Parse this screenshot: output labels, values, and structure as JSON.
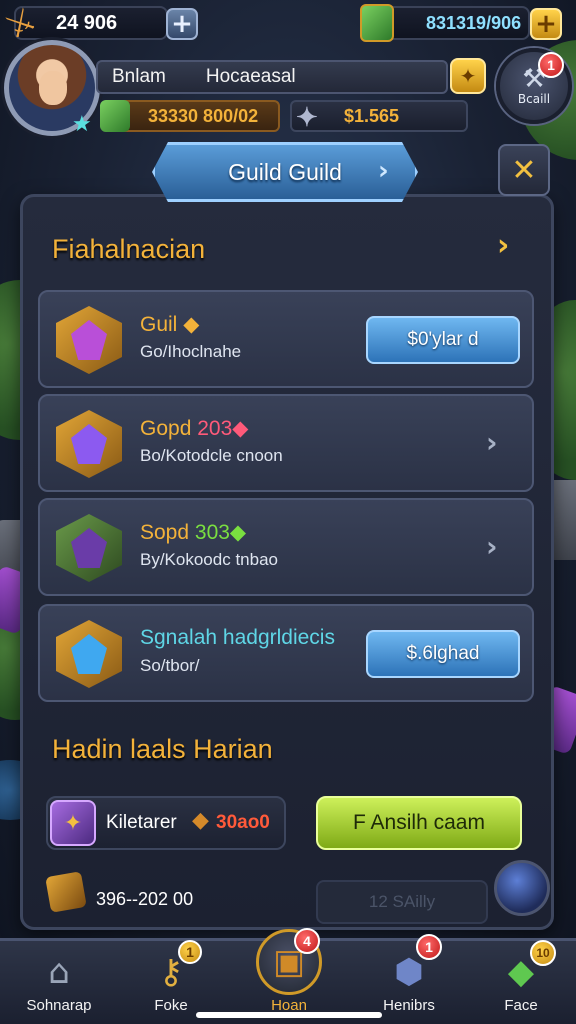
{
  "top_bar": {
    "energy": {
      "icon": "sword-icon",
      "value": "24 906",
      "plus": "+"
    },
    "gems": {
      "icon": "gem-icon",
      "value": "831319/906",
      "plus": "+"
    }
  },
  "player": {
    "name_left": "Bnlam",
    "name_right": "Hocaeasal",
    "gold_value": "33330 800/02",
    "ore_value": "$1.565"
  },
  "settings": {
    "label": "Bcaill",
    "badge": "1"
  },
  "panel": {
    "tab_label": "Guild Guild",
    "tab_arrow": "›",
    "close": "✕",
    "section1_title": "Fiahalnacian",
    "section1_arrow": "›",
    "cards": [
      {
        "title": "Guil",
        "title_suffix": "◆",
        "subtitle": "Go/Ihoclnahe",
        "button": "$0'ylar d",
        "has_button": true,
        "colors": {
          "gem": "#b94fd8",
          "frame": "#d9a237"
        }
      },
      {
        "title": "Gopd",
        "title_suffix": "203◆",
        "subtitle": "Bo/Kotodcle cnoon",
        "button": "",
        "has_button": false,
        "colors": {
          "gem": "#8c5af0",
          "frame": "#d9a237"
        }
      },
      {
        "title": "Sopd",
        "title_suffix": "303◆",
        "subtitle": "By/Kokoodc tnbao",
        "button": "",
        "has_button": false,
        "colors": {
          "gem": "#6a3ca8",
          "frame": "#4f7a36"
        }
      },
      {
        "title": "Sgnalah hadgrldiecis",
        "title_suffix": "",
        "subtitle": "So/tbor/",
        "button": "$.6lghad",
        "has_button": true,
        "colors": {
          "gem": "#3fa8f0",
          "frame": "#d9a237"
        }
      }
    ],
    "section2_title": "Hadin laals Harian",
    "promo": {
      "label": "Kiletarer",
      "value": "30ao0",
      "button": "F Ansilh caam"
    },
    "footer": {
      "text": "396--202 00",
      "dim_button": "12 SAilly"
    }
  },
  "nav": {
    "items": [
      {
        "label": "Sohnarap",
        "icon": "castle-icon",
        "glyph": "⌂",
        "badge": ""
      },
      {
        "label": "Foke",
        "icon": "key-icon",
        "glyph": "⚷",
        "badge": "1"
      },
      {
        "label": "Hoan",
        "icon": "chest-icon",
        "glyph": "▣",
        "badge": "4"
      },
      {
        "label": "Henibrs",
        "icon": "shield-icon",
        "glyph": "⬢",
        "badge": "1"
      },
      {
        "label": "Face",
        "icon": "crystal-icon",
        "glyph": "◆",
        "badge": "10"
      }
    ],
    "active_index": 2
  },
  "colors": {
    "accent_gold": "#f3b23a",
    "button_blue": "#2d73b8",
    "button_green": "#7faa16",
    "badge_red": "#c01818"
  }
}
